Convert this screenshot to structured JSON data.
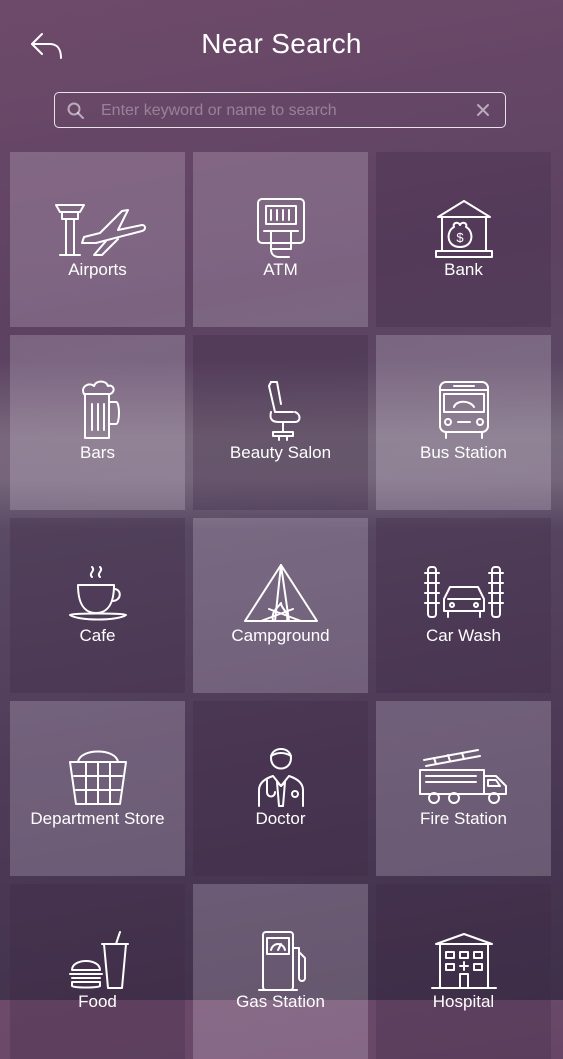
{
  "header": {
    "title": "Near Search"
  },
  "search": {
    "placeholder": "Enter keyword or name to search",
    "value": ""
  },
  "categories": [
    {
      "label": "Airports",
      "icon": "airport-icon"
    },
    {
      "label": "ATM",
      "icon": "atm-icon"
    },
    {
      "label": "Bank",
      "icon": "bank-icon"
    },
    {
      "label": "Bars",
      "icon": "beer-mug-icon"
    },
    {
      "label": "Beauty Salon",
      "icon": "salon-chair-icon"
    },
    {
      "label": "Bus Station",
      "icon": "bus-icon"
    },
    {
      "label": "Cafe",
      "icon": "coffee-cup-icon"
    },
    {
      "label": "Campground",
      "icon": "tent-icon"
    },
    {
      "label": "Car Wash",
      "icon": "car-wash-icon"
    },
    {
      "label": "Department Store",
      "icon": "shopping-basket-icon"
    },
    {
      "label": "Doctor",
      "icon": "doctor-icon"
    },
    {
      "label": "Fire Station",
      "icon": "fire-truck-icon"
    },
    {
      "label": "Food",
      "icon": "burger-drink-icon"
    },
    {
      "label": "Gas Station",
      "icon": "gas-pump-icon"
    },
    {
      "label": "Hospital",
      "icon": "hospital-icon"
    }
  ],
  "colors": {
    "background_top": "#6e4a6a",
    "background_bottom": "#3f3049",
    "foreground": "#ffffff"
  }
}
